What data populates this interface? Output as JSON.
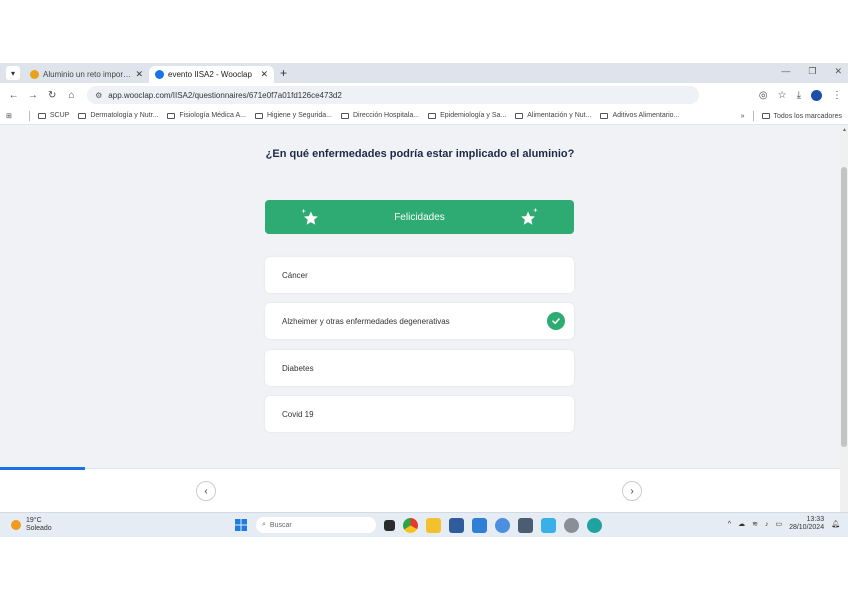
{
  "browser": {
    "tabs": [
      {
        "title": "Aluminio un reto importante pa",
        "favicon_color": "#e9a21b",
        "active": false
      },
      {
        "title": "evento IISA2 - Wooclap",
        "favicon_color": "#1a73e8",
        "active": true
      }
    ],
    "new_tab": "+",
    "url": "app.wooclap.com/IISA2/questionnaires/671e0f7a01fd126ce473d2",
    "bookmarks": [
      "SCUP",
      "Dermatología y Nutr...",
      "Fisiología Médica A...",
      "Higiene y Segurida...",
      "Dirección Hospitala...",
      "Epidemiología y Sa...",
      "Alimentación y Nut...",
      "Aditivos Alimentario..."
    ],
    "bookmarks_all": "Todos los marcadores"
  },
  "quiz": {
    "question": "¿En qué enfermedades podría estar implicado el aluminio?",
    "banner": "Felicidades",
    "options": [
      {
        "label": "Cáncer",
        "correct": false
      },
      {
        "label": "Alzheimer y otras enfermedades degenerativas",
        "correct": true
      },
      {
        "label": "Diabetes",
        "correct": false
      },
      {
        "label": "Covid 19",
        "correct": false
      }
    ],
    "accent_color": "#2eab72"
  },
  "nav": {
    "prev": "‹",
    "next": "›"
  },
  "taskbar": {
    "weather_temp": "19°C",
    "weather_desc": "Soleado",
    "search_placeholder": "Buscar",
    "time": "13:33",
    "date": "28/10/2024"
  }
}
